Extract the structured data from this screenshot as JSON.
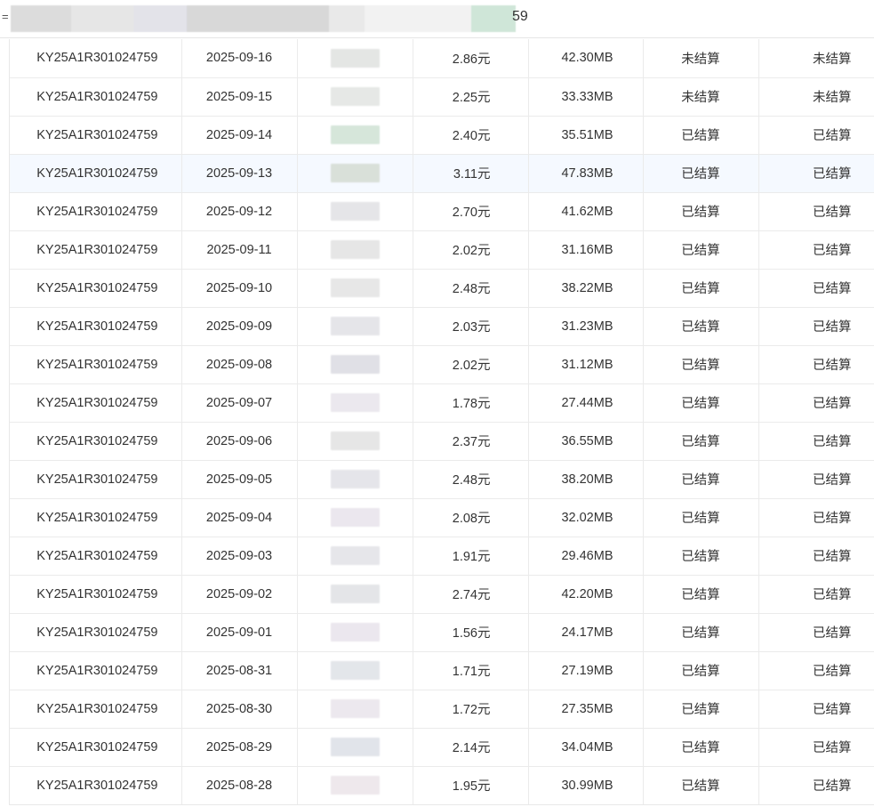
{
  "header": {
    "lead_glyph": "=",
    "tail_text": "59",
    "redaction_colors": [
      "#dcdcdc",
      "#e6e6e6",
      "#e3e3e9",
      "#d8d8d8",
      "#e9e9e9",
      "#f2f2f2",
      "#cfe6d8"
    ]
  },
  "table": {
    "rows": [
      {
        "id": "KY25A1R301024759",
        "date": "2025-09-16",
        "amount": "2.86元",
        "size": "42.30MB",
        "status1": "未结算",
        "status2": "未结算",
        "redaction_color": "#e4e6e4"
      },
      {
        "id": "KY25A1R301024759",
        "date": "2025-09-15",
        "amount": "2.25元",
        "size": "33.33MB",
        "status1": "未结算",
        "status2": "未结算",
        "redaction_color": "#e6e8e6"
      },
      {
        "id": "KY25A1R301024759",
        "date": "2025-09-14",
        "amount": "2.40元",
        "size": "35.51MB",
        "status1": "已结算",
        "status2": "已结算",
        "redaction_color": "#d6e6da"
      },
      {
        "id": "KY25A1R301024759",
        "date": "2025-09-13",
        "amount": "3.11元",
        "size": "47.83MB",
        "status1": "已结算",
        "status2": "已结算",
        "redaction_color": "#d9e0d9"
      },
      {
        "id": "KY25A1R301024759",
        "date": "2025-09-12",
        "amount": "2.70元",
        "size": "41.62MB",
        "status1": "已结算",
        "status2": "已结算",
        "redaction_color": "#e5e5e8"
      },
      {
        "id": "KY25A1R301024759",
        "date": "2025-09-11",
        "amount": "2.02元",
        "size": "31.16MB",
        "status1": "已结算",
        "status2": "已结算",
        "redaction_color": "#e6e6e6"
      },
      {
        "id": "KY25A1R301024759",
        "date": "2025-09-10",
        "amount": "2.48元",
        "size": "38.22MB",
        "status1": "已结算",
        "status2": "已结算",
        "redaction_color": "#e7e7e7"
      },
      {
        "id": "KY25A1R301024759",
        "date": "2025-09-09",
        "amount": "2.03元",
        "size": "31.23MB",
        "status1": "已结算",
        "status2": "已结算",
        "redaction_color": "#e5e5e9"
      },
      {
        "id": "KY25A1R301024759",
        "date": "2025-09-08",
        "amount": "2.02元",
        "size": "31.12MB",
        "status1": "已结算",
        "status2": "已结算",
        "redaction_color": "#e0e0e6"
      },
      {
        "id": "KY25A1R301024759",
        "date": "2025-09-07",
        "amount": "1.78元",
        "size": "27.44MB",
        "status1": "已结算",
        "status2": "已结算",
        "redaction_color": "#ebe8ee"
      },
      {
        "id": "KY25A1R301024759",
        "date": "2025-09-06",
        "amount": "2.37元",
        "size": "36.55MB",
        "status1": "已结算",
        "status2": "已结算",
        "redaction_color": "#e6e6e6"
      },
      {
        "id": "KY25A1R301024759",
        "date": "2025-09-05",
        "amount": "2.48元",
        "size": "38.20MB",
        "status1": "已结算",
        "status2": "已结算",
        "redaction_color": "#e5e5ea"
      },
      {
        "id": "KY25A1R301024759",
        "date": "2025-09-04",
        "amount": "2.08元",
        "size": "32.02MB",
        "status1": "已结算",
        "status2": "已结算",
        "redaction_color": "#ebe7ee"
      },
      {
        "id": "KY25A1R301024759",
        "date": "2025-09-03",
        "amount": "1.91元",
        "size": "29.46MB",
        "status1": "已结算",
        "status2": "已结算",
        "redaction_color": "#e6e6ea"
      },
      {
        "id": "KY25A1R301024759",
        "date": "2025-09-02",
        "amount": "2.74元",
        "size": "42.20MB",
        "status1": "已结算",
        "status2": "已结算",
        "redaction_color": "#e4e5e8"
      },
      {
        "id": "KY25A1R301024759",
        "date": "2025-09-01",
        "amount": "1.56元",
        "size": "24.17MB",
        "status1": "已结算",
        "status2": "已结算",
        "redaction_color": "#ebe7ee"
      },
      {
        "id": "KY25A1R301024759",
        "date": "2025-08-31",
        "amount": "1.71元",
        "size": "27.19MB",
        "status1": "已结算",
        "status2": "已结算",
        "redaction_color": "#e3e6ea"
      },
      {
        "id": "KY25A1R301024759",
        "date": "2025-08-30",
        "amount": "1.72元",
        "size": "27.35MB",
        "status1": "已结算",
        "status2": "已结算",
        "redaction_color": "#ece8ee"
      },
      {
        "id": "KY25A1R301024759",
        "date": "2025-08-29",
        "amount": "2.14元",
        "size": "34.04MB",
        "status1": "已结算",
        "status2": "已结算",
        "redaction_color": "#e1e4ea"
      },
      {
        "id": "KY25A1R301024759",
        "date": "2025-08-28",
        "amount": "1.95元",
        "size": "30.99MB",
        "status1": "已结算",
        "status2": "已结算",
        "redaction_color": "#eee8ec"
      }
    ],
    "highlighted_row": 3,
    "colors": {
      "highlight_bg": "#f5f9ff",
      "border": "#ebebeb",
      "text": "#333333"
    }
  }
}
